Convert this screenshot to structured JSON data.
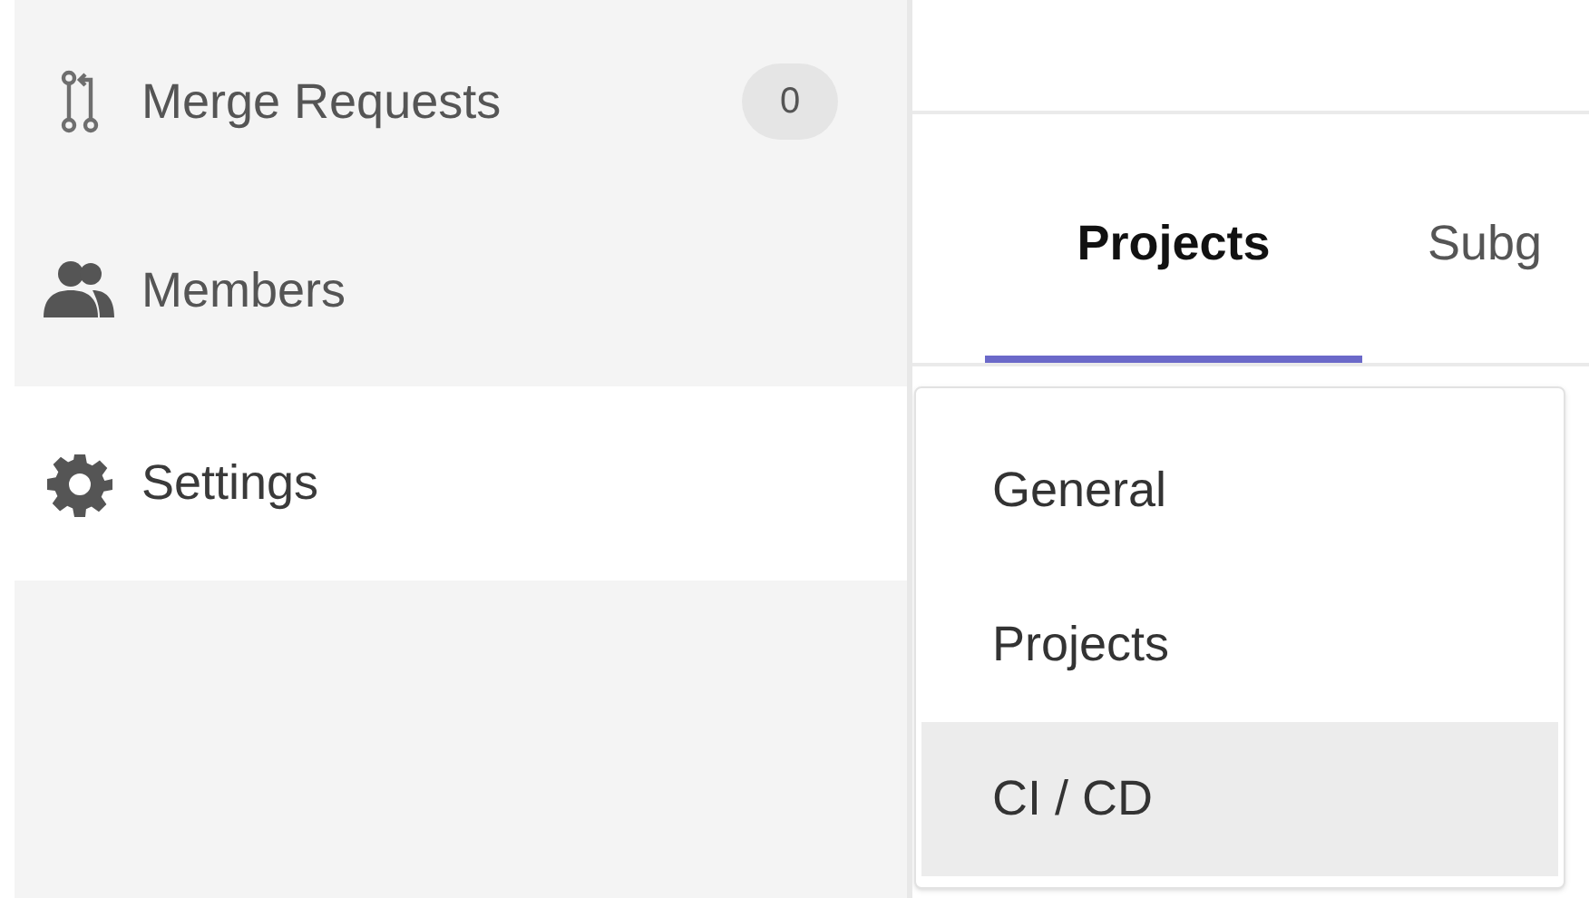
{
  "sidebar": {
    "items": [
      {
        "label": "Merge Requests",
        "badge": "0",
        "selected": false
      },
      {
        "label": "Members",
        "selected": false
      },
      {
        "label": "Settings",
        "selected": true
      }
    ]
  },
  "tabs": [
    {
      "label": "Projects",
      "selected": true
    },
    {
      "label": "Subg",
      "selected": false
    }
  ],
  "settings_menu": {
    "items": [
      {
        "label": "General",
        "selected": false
      },
      {
        "label": "Projects",
        "selected": false
      },
      {
        "label": "CI / CD",
        "selected": true
      }
    ]
  }
}
